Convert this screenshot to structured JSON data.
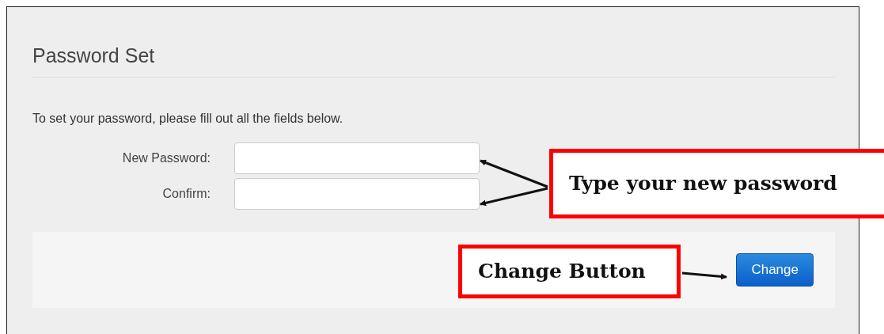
{
  "panel": {
    "title": "Password Set",
    "instructions": "To set your password, please fill out all the fields below.",
    "fields": [
      {
        "label": "New Password:"
      },
      {
        "label": "Confirm:"
      }
    ],
    "button": "Change"
  },
  "annotations": [
    {
      "text": "Type your new password"
    },
    {
      "text": "Change Button"
    }
  ]
}
